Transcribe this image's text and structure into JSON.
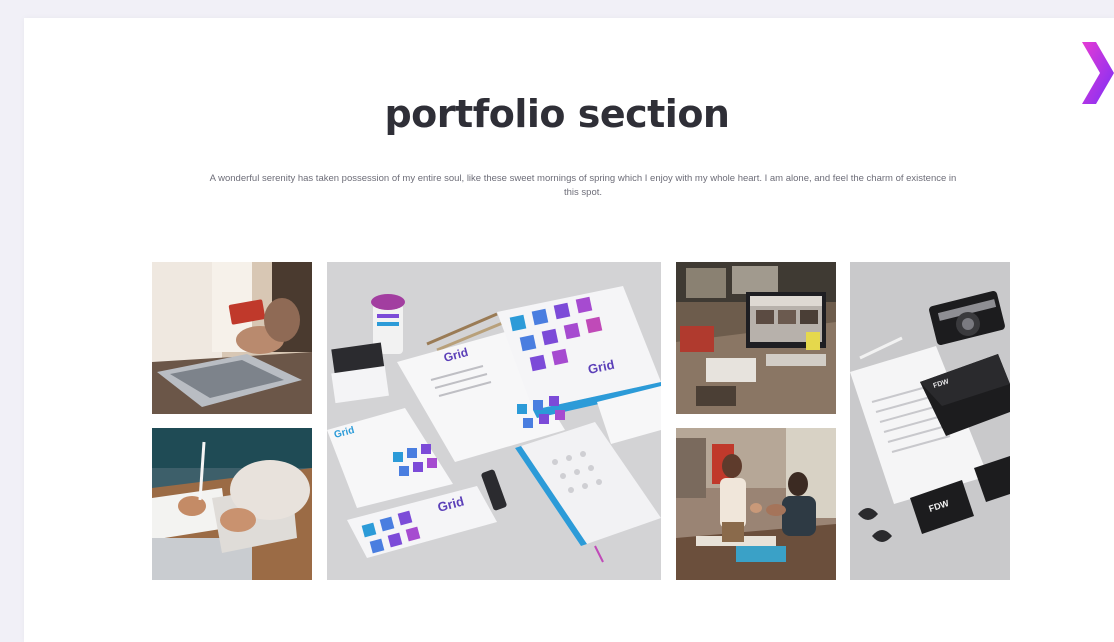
{
  "section": {
    "title": "portfolio section",
    "description": "A wonderful serenity has taken possession of my entire soul, like these sweet mornings of spring which I enjoy with my whole heart. I am alone, and feel the charm of existence in this spot."
  },
  "navigation": {
    "next_icon": "chevron-right-icon"
  },
  "colors": {
    "accent_gradient_start": "#e63bd4",
    "accent_gradient_end": "#7b2ff7",
    "title": "#2f2f37",
    "text": "#6d6d78"
  },
  "portfolio": {
    "items": [
      {
        "subject": "laptop-credit-card-photo"
      },
      {
        "subject": "tablet-notes-photo"
      },
      {
        "subject": "brand-stationery-mockup",
        "brand_text": "Grid"
      },
      {
        "subject": "office-desk-monitor-photo"
      },
      {
        "subject": "team-meeting-photo"
      },
      {
        "subject": "black-white-stationery-mockup",
        "brand_text": "FDW"
      }
    ]
  }
}
